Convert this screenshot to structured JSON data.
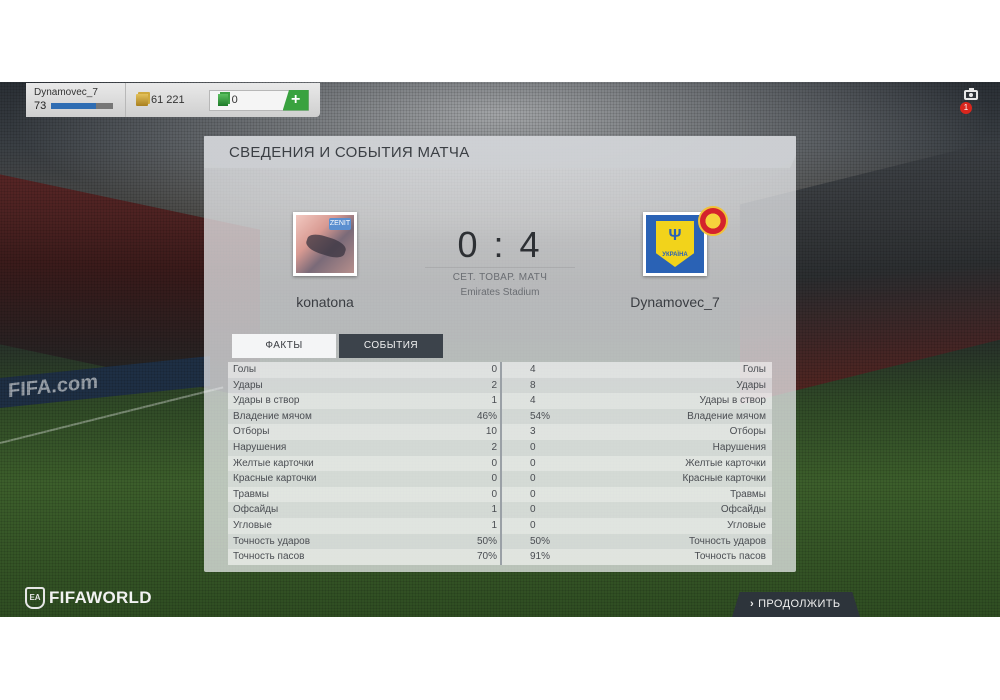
{
  "profile": {
    "username": "Dynamovec_7",
    "level": "73",
    "xp_progress": 0.72,
    "coins": "61 221",
    "points": "0",
    "add_points_symbol": "+"
  },
  "notifications": {
    "count": "1",
    "icon": "camera-icon"
  },
  "panel": {
    "title": "СВЕДЕНИЯ И СОБЫТИЯ МАТЧА",
    "home": {
      "name": "konatona",
      "avatar_mark": "ZENIT"
    },
    "away": {
      "name": "Dynamovec_7",
      "crest_text": "УКРАЇНА",
      "crest_symbol": "Ψ"
    },
    "score": "0 : 4",
    "match_type": "СЕТ. ТОВАР. МАТЧ",
    "stadium": "Emirates Stadium",
    "tabs": [
      "ФАКТЫ",
      "СОБЫТИЯ"
    ]
  },
  "stats": [
    {
      "label": "Голы",
      "home": "0",
      "away": "4"
    },
    {
      "label": "Удары",
      "home": "2",
      "away": "8"
    },
    {
      "label": "Удары в створ",
      "home": "1",
      "away": "4"
    },
    {
      "label": "Владение мячом",
      "home": "46%",
      "away": "54%"
    },
    {
      "label": "Отборы",
      "home": "10",
      "away": "3"
    },
    {
      "label": "Нарушения",
      "home": "2",
      "away": "0"
    },
    {
      "label": "Желтые карточки",
      "home": "0",
      "away": "0"
    },
    {
      "label": "Красные карточки",
      "home": "0",
      "away": "0"
    },
    {
      "label": "Травмы",
      "home": "0",
      "away": "0"
    },
    {
      "label": "Офсайды",
      "home": "1",
      "away": "0"
    },
    {
      "label": "Угловые",
      "home": "1",
      "away": "0"
    },
    {
      "label": "Точность ударов",
      "home": "50%",
      "away": "50%"
    },
    {
      "label": "Точность пасов",
      "home": "70%",
      "away": "91%"
    }
  ],
  "branding": {
    "logo": "FIFAWORLD",
    "shield": "EA"
  },
  "footer": {
    "continue_label": "ПРОДОЛЖИТЬ",
    "continue_chevron": "›"
  },
  "background": {
    "ad_text": "FIFA.com"
  },
  "colors": {
    "accent_green": "#39a23f",
    "xp_blue": "#2f6db3",
    "dark_button": "#2d343b",
    "badge_red": "#d8261d"
  }
}
